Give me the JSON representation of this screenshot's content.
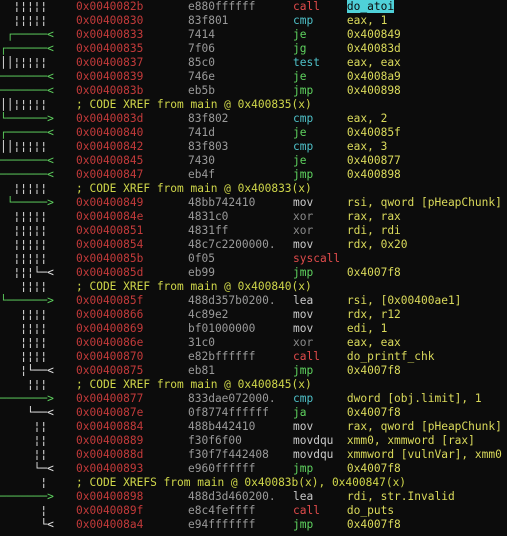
{
  "listing": [
    {
      "g": "  ¦¦¦¦¦  ",
      "gc": "gy",
      "a": "0x0040082b",
      "b": "e880ffffff",
      "m": "call",
      "mc": "m-red",
      "ops": "do_atoi",
      "oc": "op-hl"
    },
    {
      "g": "  ¦¦¦¦¦  ",
      "gc": "gy",
      "a": "0x00400830",
      "b": "83f801",
      "m": "cmp",
      "mc": "m-cyan",
      "ops": "eax, 1",
      "oc": "op-num"
    },
    {
      "g": " ┌─────< ",
      "gc": "gg",
      "a": "0x00400833",
      "b": "7414",
      "m": "je",
      "mc": "m-grn",
      "ops": "0x400849",
      "oc": "op-num"
    },
    {
      "g": "┌──────< ",
      "gc": "gg",
      "a": "0x00400835",
      "b": "7f06",
      "m": "jg",
      "mc": "m-grn",
      "ops": "0x40083d",
      "oc": "op-num"
    },
    {
      "g": "││¦¦¦¦¦  ",
      "gc": "gy",
      "a": "0x00400837",
      "b": "85c0",
      "m": "test",
      "mc": "m-cyan",
      "ops": "eax, eax",
      "oc": "op-num"
    },
    {
      "g": "───────< ",
      "gc": "gg",
      "a": "0x00400839",
      "b": "746e",
      "m": "je",
      "mc": "m-grn",
      "ops": "0x4008a9",
      "oc": "op-num"
    },
    {
      "g": "───────< ",
      "gc": "gg",
      "a": "0x0040083b",
      "b": "eb5b",
      "m": "jmp",
      "mc": "m-grn",
      "ops": "0x400898",
      "oc": "op-num"
    },
    {
      "x": "; CODE XREF from main @ 0x400835(x)",
      "g": "││¦¦¦¦¦  ",
      "gc": "gy"
    },
    {
      "g": "└──────> ",
      "gc": "gg",
      "a": "0x0040083d",
      "b": "83f802",
      "m": "cmp",
      "mc": "m-cyan",
      "ops": "eax, 2",
      "oc": "op-num"
    },
    {
      "g": "┌──────< ",
      "gc": "gg",
      "a": "0x00400840",
      "b": "741d",
      "m": "je",
      "mc": "m-grn",
      "ops": "0x40085f",
      "oc": "op-num"
    },
    {
      "g": "││¦¦¦¦¦  ",
      "gc": "gy",
      "a": "0x00400842",
      "b": "83f803",
      "m": "cmp",
      "mc": "m-cyan",
      "ops": "eax, 3",
      "oc": "op-num"
    },
    {
      "g": "───────< ",
      "gc": "gg",
      "a": "0x00400845",
      "b": "7430",
      "m": "je",
      "mc": "m-grn",
      "ops": "0x400877",
      "oc": "op-num"
    },
    {
      "g": "───────< ",
      "gc": "gg",
      "a": "0x00400847",
      "b": "eb4f",
      "m": "jmp",
      "mc": "m-grn",
      "ops": "0x400898",
      "oc": "op-num"
    },
    {
      "x": "; CODE XREF from main @ 0x400833(x)",
      "g": "  ¦¦¦¦¦  ",
      "gc": "gy"
    },
    {
      "g": " └─────> ",
      "gc": "gg",
      "a": "0x00400849",
      "b": "48bb742410",
      "m": "mov",
      "mc": "m-std",
      "ops": "rsi, qword [pHeapChunk]",
      "oc": "op-mem"
    },
    {
      "g": "  ¦¦¦¦¦  ",
      "gc": "gy",
      "a": "0x0040084e",
      "b": "4831c0",
      "m": "xor",
      "mc": "m-gray",
      "ops": "rax, rax",
      "oc": "op-num"
    },
    {
      "g": "  ¦¦¦¦¦  ",
      "gc": "gy",
      "a": "0x00400851",
      "b": "4831ff",
      "m": "xor",
      "mc": "m-gray",
      "ops": "rdi, rdi",
      "oc": "op-num"
    },
    {
      "g": "  ¦¦¦¦¦  ",
      "gc": "gy",
      "a": "0x00400854",
      "b": "48c7c2200000.",
      "m": "mov",
      "mc": "m-std",
      "ops": "rdx, 0x20",
      "oc": "op-num"
    },
    {
      "g": "  ¦¦¦¦¦  ",
      "gc": "gy",
      "a": "0x0040085b",
      "b": "0f05",
      "m": "syscall",
      "mc": "m-red",
      "ops": "",
      "oc": "op-num"
    },
    {
      "g": "  ¦¦¦└─< ",
      "gc": "gy",
      "a": "0x0040085d",
      "b": "eb99",
      "m": "jmp",
      "mc": "m-grn",
      "ops": "0x4007f8",
      "oc": "op-num"
    },
    {
      "x": "; CODE XREF from main @ 0x400840(x)",
      "g": "   ¦¦¦¦  ",
      "gc": "gy"
    },
    {
      "g": "└──────> ",
      "gc": "gg",
      "a": "0x0040085f",
      "b": "488d357b0200.",
      "m": "lea",
      "mc": "m-std",
      "ops": "rsi, [0x00400ae1]",
      "oc": "op-mem"
    },
    {
      "g": "   ¦¦¦¦  ",
      "gc": "gy",
      "a": "0x00400866",
      "b": "4c89e2",
      "m": "mov",
      "mc": "m-std",
      "ops": "rdx, r12",
      "oc": "op-num"
    },
    {
      "g": "   ¦¦¦¦  ",
      "gc": "gy",
      "a": "0x00400869",
      "b": "bf01000000",
      "m": "mov",
      "mc": "m-std",
      "ops": "edi, 1",
      "oc": "op-num"
    },
    {
      "g": "   ¦¦¦¦  ",
      "gc": "gy",
      "a": "0x0040086e",
      "b": "31c0",
      "m": "xor",
      "mc": "m-gray",
      "ops": "eax, eax",
      "oc": "op-num"
    },
    {
      "g": "   ¦¦¦¦  ",
      "gc": "gy",
      "a": "0x00400870",
      "b": "e82bffffff",
      "m": "call",
      "mc": "m-red",
      "ops": "do_printf_chk",
      "oc": "op-num"
    },
    {
      "g": "   ¦└──< ",
      "gc": "gy",
      "a": "0x00400875",
      "b": "eb81",
      "m": "jmp",
      "mc": "m-grn",
      "ops": "0x4007f8",
      "oc": "op-num"
    },
    {
      "x": "; CODE XREF from main @ 0x400845(x)",
      "g": "    ¦¦¦  ",
      "gc": "gy"
    },
    {
      "g": "───────> ",
      "gc": "gg",
      "a": "0x00400877",
      "b": "833dae072000.",
      "m": "cmp",
      "mc": "m-cyan",
      "ops": "dword [obj.limit], 1",
      "oc": "op-mem"
    },
    {
      "g": "    └──< ",
      "gc": "gy",
      "a": "0x0040087e",
      "b": "0f8774ffffff",
      "m": "ja",
      "mc": "m-grn",
      "ops": "0x4007f8",
      "oc": "op-num"
    },
    {
      "g": "     ¦¦  ",
      "gc": "gy",
      "a": "0x00400884",
      "b": "488b442410",
      "m": "mov",
      "mc": "m-std",
      "ops": "rax, qword [pHeapChunk]",
      "oc": "op-mem"
    },
    {
      "g": "     ¦¦  ",
      "gc": "gy",
      "a": "0x00400889",
      "b": "f30f6f00",
      "m": "movdqu",
      "mc": "m-std",
      "ops": "xmm0, xmmword [rax]",
      "oc": "op-mem"
    },
    {
      "g": "     ¦¦  ",
      "gc": "gy",
      "a": "0x0040088d",
      "b": "f30f7f442408",
      "m": "movdqu",
      "mc": "m-std",
      "ops": "xmmword [vulnVar], xmm0",
      "oc": "op-mem"
    },
    {
      "g": "     └─< ",
      "gc": "gy",
      "a": "0x00400893",
      "b": "e960ffffff",
      "m": "jmp",
      "mc": "m-grn",
      "ops": "0x4007f8",
      "oc": "op-num"
    },
    {
      "x": "; CODE XREFS from main @ 0x40083b(x), 0x400847(x)",
      "g": "      ¦  ",
      "gc": "gy"
    },
    {
      "g": "───────> ",
      "gc": "gg",
      "a": "0x00400898",
      "b": "488d3d460200.",
      "m": "lea",
      "mc": "m-std",
      "ops": "rdi, str.Invalid",
      "oc": "op-num"
    },
    {
      "g": "      ¦  ",
      "gc": "gy",
      "a": "0x0040089f",
      "b": "e8c4feffff",
      "m": "call",
      "mc": "m-red",
      "ops": "do_puts",
      "oc": "op-num"
    },
    {
      "g": "      └< ",
      "gc": "gy",
      "a": "0x004008a4",
      "b": "e94fffffff",
      "m": "jmp",
      "mc": "m-grn",
      "ops": "0x4007f8",
      "oc": "op-num"
    }
  ]
}
